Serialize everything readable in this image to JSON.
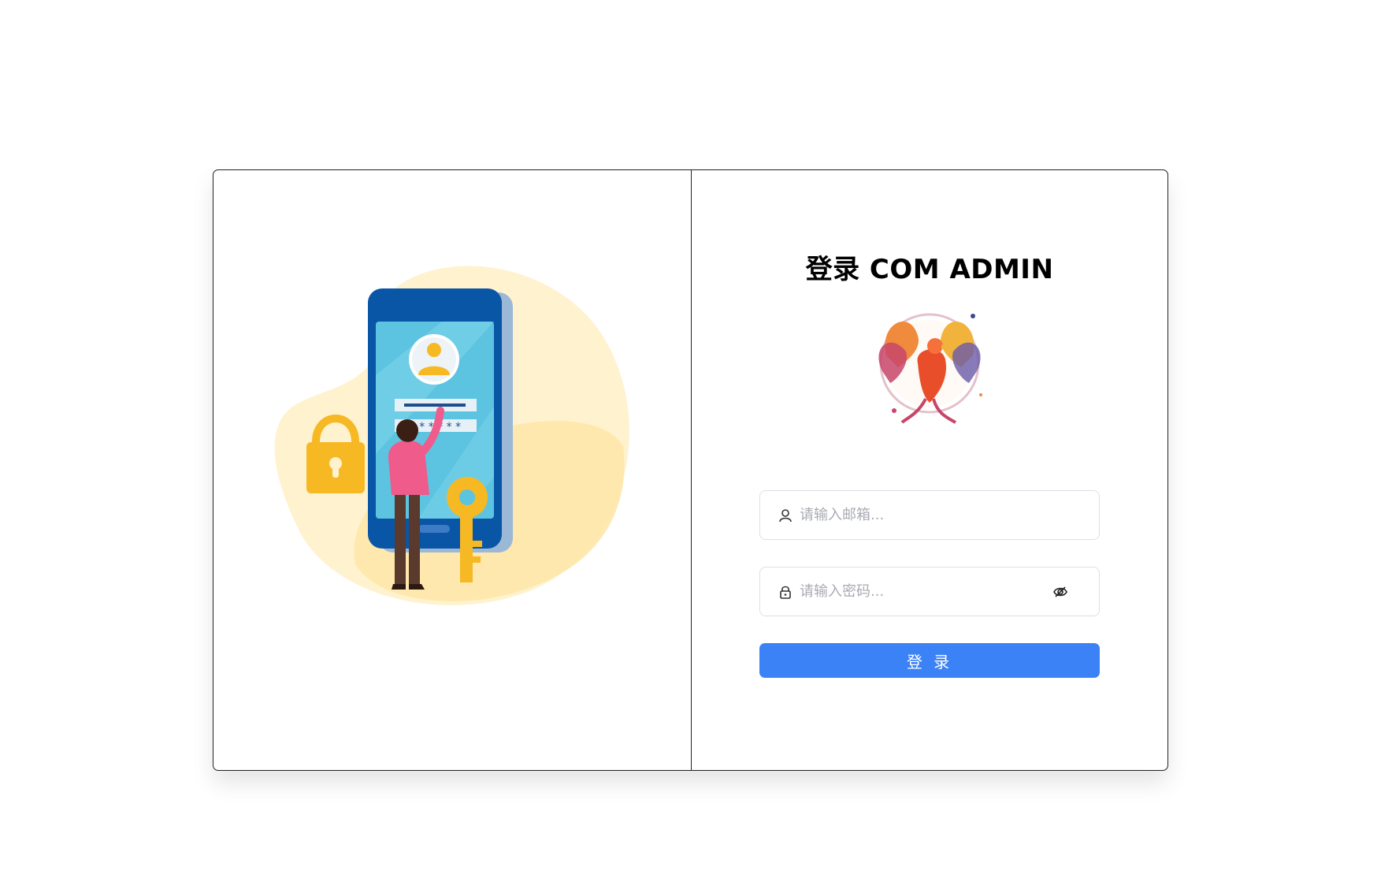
{
  "login": {
    "title": "登录 COM ADMIN",
    "email_placeholder": "请输入邮箱...",
    "password_placeholder": "请输入密码...",
    "submit_label": "登 录"
  },
  "icons": {
    "email_field": "user-icon",
    "password_field": "lock-icon",
    "password_toggle": "eye-off-icon"
  },
  "colors": {
    "primary": "#3b82f6",
    "border": "#dcdfe6",
    "placeholder": "#a8abb2"
  }
}
